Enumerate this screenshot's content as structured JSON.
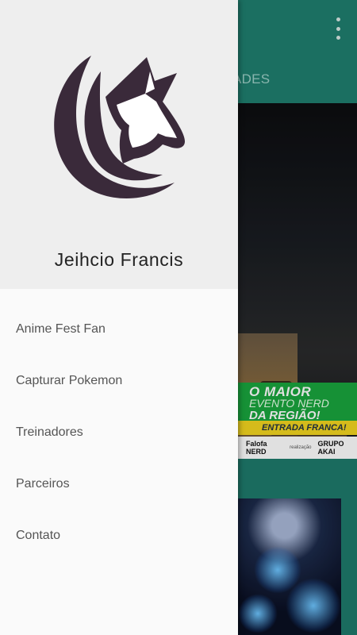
{
  "app": {
    "tab_visible_label": "TIVIDADES",
    "overflow_icon": "more-vert-icon"
  },
  "banner": {
    "headline_1": "O MAIOR",
    "headline_2": "EVENTO NERD",
    "headline_3": "DA REGIÃO!",
    "entry_text": "ENTRADA FRANCA!",
    "sponsor_1": "Falofa NERD",
    "sponsor_small": "realização",
    "sponsor_2": "GRUPO AKAI"
  },
  "drawer": {
    "logo_icon": "wolf-logo-icon",
    "user_name": "Jeihcio Francis",
    "items": [
      {
        "label": "Anime Fest Fan"
      },
      {
        "label": "Capturar Pokemon"
      },
      {
        "label": "Treinadores"
      },
      {
        "label": "Parceiros"
      },
      {
        "label": "Contato"
      }
    ]
  },
  "colors": {
    "primary": "#1f7f6f",
    "drawer_bg": "#fafafa",
    "header_bg": "#eeeeee",
    "logo": "#3a2a3a"
  }
}
